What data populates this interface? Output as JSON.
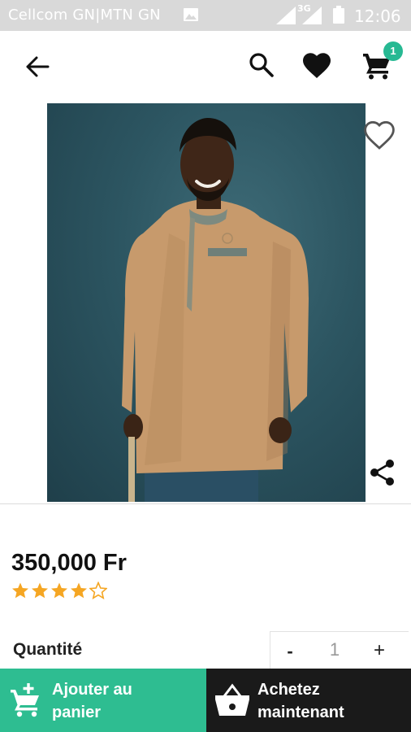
{
  "status_bar": {
    "carrier": "Cellcom GN|MTN GN",
    "network": "3G",
    "time": "12:06"
  },
  "toolbar": {
    "back_icon": "arrow-left-icon",
    "search_icon": "search-icon",
    "favorites_icon": "heart-filled-icon",
    "cart_icon": "cart-icon",
    "cart_count": "1"
  },
  "product": {
    "image_icon": "product-photo",
    "wishlist_icon": "heart-outline-icon",
    "share_icon": "share-icon",
    "price": "350,000 Fr",
    "rating": 4,
    "rating_max": 5
  },
  "quantity": {
    "label": "Quantité",
    "minus": "-",
    "value": "1",
    "plus": "+"
  },
  "actions": {
    "add_to_cart": "Ajouter au panier",
    "buy_now": "Achetez maintenant"
  },
  "colors": {
    "accent": "#2ebd91",
    "badge": "#27b993",
    "star": "#f5a623",
    "buy_button": "#1a1a1a"
  }
}
